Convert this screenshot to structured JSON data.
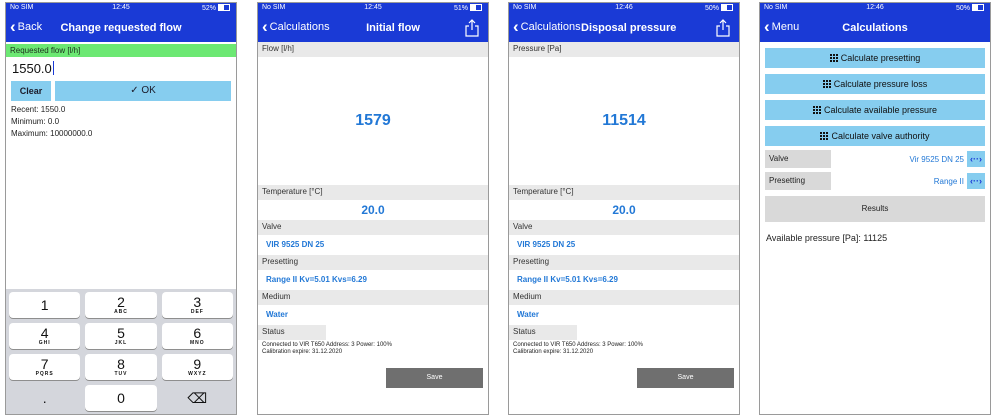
{
  "phone1": {
    "status": {
      "carrier": "No SIM",
      "time": "12:45",
      "battery": "52%"
    },
    "nav": {
      "back": "Back",
      "title": "Change requested flow"
    },
    "field_label": "Requested flow [l/h]",
    "value": "1550.0",
    "clear": "Clear",
    "ok": "✓ OK",
    "recent": "Recent: 1550.0",
    "minimum": "Minimum: 0.0",
    "maximum": "Maximum: 10000000.0",
    "keys": [
      {
        "d": "1",
        "l": ""
      },
      {
        "d": "2",
        "l": "ABC"
      },
      {
        "d": "3",
        "l": "DEF"
      },
      {
        "d": "4",
        "l": "GHI"
      },
      {
        "d": "5",
        "l": "JKL"
      },
      {
        "d": "6",
        "l": "MNO"
      },
      {
        "d": "7",
        "l": "PQRS"
      },
      {
        "d": "8",
        "l": "TUV"
      },
      {
        "d": "9",
        "l": "WXYZ"
      },
      {
        "d": ".",
        "l": ""
      },
      {
        "d": "0",
        "l": ""
      },
      {
        "d": "⌫",
        "l": ""
      }
    ]
  },
  "phone2": {
    "status": {
      "carrier": "No SIM",
      "time": "12:45",
      "battery": "51%"
    },
    "nav": {
      "back": "Calculations",
      "title": "Initial flow"
    },
    "main_label": "Flow [l/h]",
    "main_value": "1579",
    "temp_label": "Temperature [°C]",
    "temp_value": "20.0",
    "valve_label": "Valve",
    "valve_value": "VIR 9525   DN 25",
    "presetting_label": "Presetting",
    "presetting_value": "Range II Kv=5.01 Kvs=6.29",
    "medium_label": "Medium",
    "medium_value": "Water",
    "status_label": "Status",
    "status_text": "Connected to VIR T650 Address: 3 Power: 100% Calibration expire: 31.12.2020",
    "save": "Save"
  },
  "phone3": {
    "status": {
      "carrier": "No SIM",
      "time": "12:46",
      "battery": "50%"
    },
    "nav": {
      "back": "Calculations",
      "title": "Disposal pressure"
    },
    "main_label": "Pressure [Pa]",
    "main_value": "11514",
    "temp_label": "Temperature [°C]",
    "temp_value": "20.0",
    "valve_label": "Valve",
    "valve_value": "VIR 9525   DN 25",
    "presetting_label": "Presetting",
    "presetting_value": "Range II Kv=5.01 Kvs=6.29",
    "medium_label": "Medium",
    "medium_value": "Water",
    "status_label": "Status",
    "status_text": "Connected to VIR T650 Address: 3 Power: 100% Calibration expire: 31.12.2020",
    "save": "Save"
  },
  "phone4": {
    "status": {
      "carrier": "No SIM",
      "time": "12:46",
      "battery": "50%"
    },
    "nav": {
      "back": "Menu",
      "title": "Calculations"
    },
    "buttons": [
      "Calculate presetting",
      "Calculate pressure loss",
      "Calculate available pressure",
      "Calculate valve authority"
    ],
    "valve_label": "Valve",
    "valve_value": "Vir 9525   DN 25",
    "presetting_label": "Presetting",
    "presetting_value": "Range II",
    "results": "Results",
    "available": "Available pressure [Pa]: 11125"
  },
  "colors": {
    "nav": "#1a3ad6",
    "accent_button": "#86cdef",
    "highlight_green": "#6ce873",
    "value_blue": "#2278d6"
  }
}
